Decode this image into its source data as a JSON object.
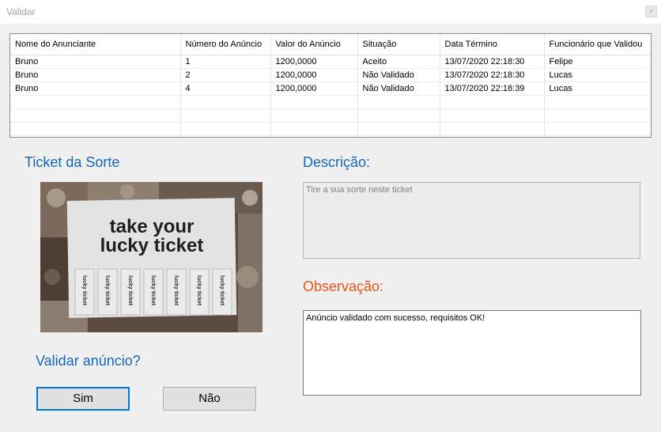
{
  "window": {
    "title": "Validar",
    "close_symbol": "×"
  },
  "grid": {
    "columns": [
      "Nome do Anunciante",
      "Número do Anúncio",
      "Valor do Anúncio",
      "Situação",
      "Data Término",
      "Funcionário que Validou"
    ],
    "rows": [
      [
        "Bruno",
        "1",
        "1200,0000",
        "Aceito",
        "13/07/2020 22:18:30",
        "Felipe"
      ],
      [
        "Bruno",
        "2",
        "1200,0000",
        "Não Validado",
        "13/07/2020 22:18:30",
        "Lucas"
      ],
      [
        "Bruno",
        "4",
        "1200,0000",
        "Não Validado",
        "13/07/2020 22:18:39",
        "Lucas"
      ]
    ]
  },
  "ticket": {
    "heading": "Ticket da Sorte",
    "image_text_line1": "take your",
    "image_text_line2": "lucky ticket",
    "tab_text": "lucky ticket"
  },
  "descricao": {
    "heading": "Descrição:",
    "value": "Tire a sua sorte neste ticket"
  },
  "observacao": {
    "heading": "Observação:",
    "value": "Anúncio validado com sucesso, requisitos OK!"
  },
  "validar": {
    "question": "Validar anúncio?",
    "yes_label": "Sim",
    "no_label": "Não"
  },
  "colors": {
    "heading_blue": "#1668b8",
    "heading_orange": "#e8531a",
    "focus_border": "#0078d7"
  }
}
